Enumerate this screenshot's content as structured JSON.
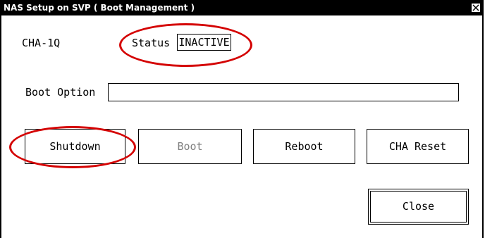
{
  "window": {
    "title": "NAS Setup on SVP ( Boot Management )",
    "close_icon": "close-icon"
  },
  "adapter": {
    "name": "CHA-1Q"
  },
  "status": {
    "label": "Status",
    "value": "INACTIVE"
  },
  "boot_option": {
    "label": "Boot Option",
    "value": ""
  },
  "buttons": {
    "shutdown": "Shutdown",
    "boot": "Boot",
    "reboot": "Reboot",
    "cha_reset": "CHA Reset",
    "close": "Close"
  },
  "colors": {
    "annotation": "#d40000",
    "disabled_text": "#808080"
  }
}
